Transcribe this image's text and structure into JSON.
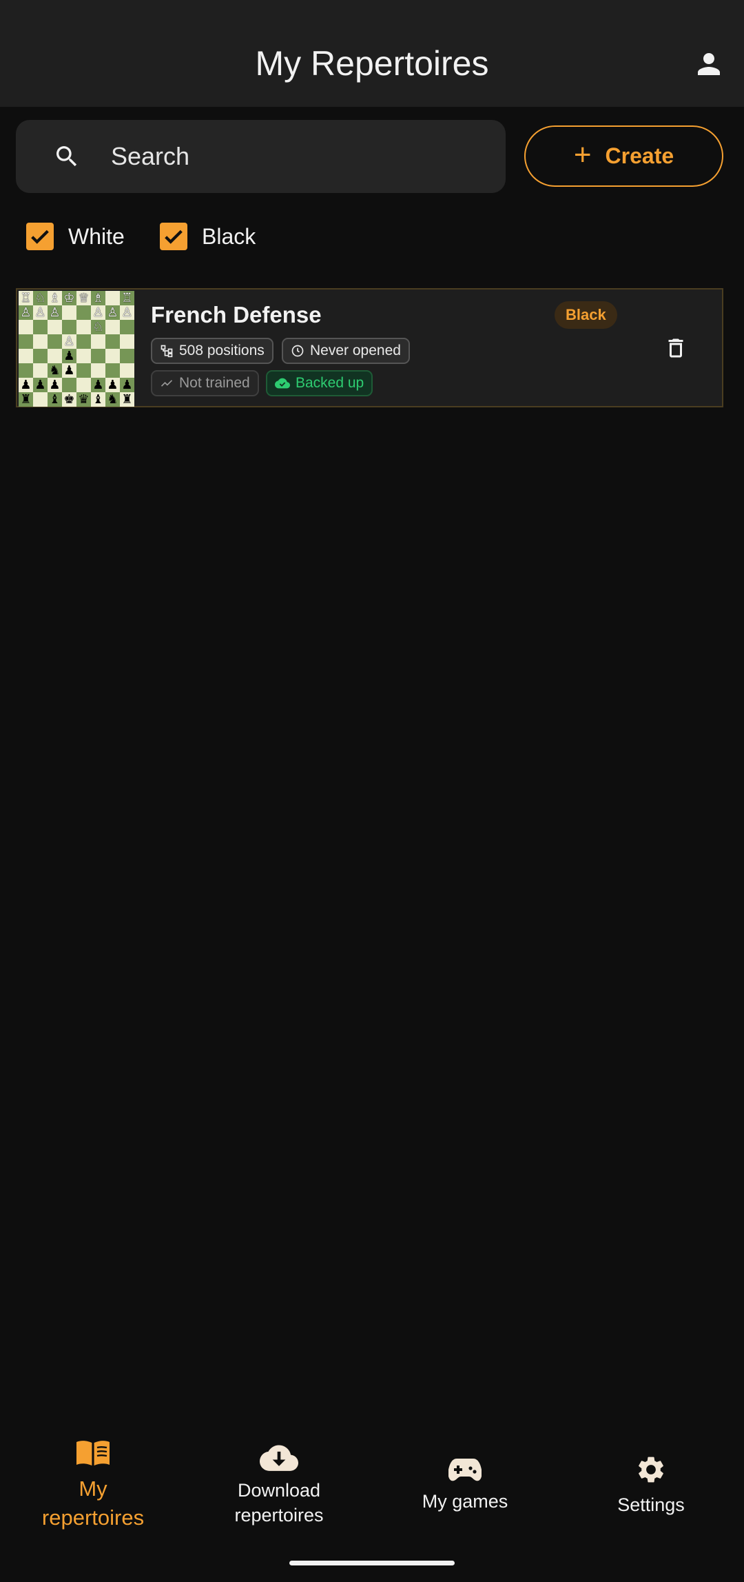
{
  "header": {
    "title": "My Repertoires",
    "account_icon": "person-icon"
  },
  "search": {
    "placeholder": "Search",
    "value": "",
    "icon": "search-icon"
  },
  "create_button": {
    "label": "Create",
    "icon": "plus-icon"
  },
  "filters": [
    {
      "label": "White",
      "checked": true
    },
    {
      "label": "Black",
      "checked": true
    }
  ],
  "repertoires": [
    {
      "name": "French Defense",
      "color_tag": "Black",
      "positions": "508 positions",
      "last_opened": "Never opened",
      "training": "Not trained",
      "backup": "Backed up",
      "delete_icon": "trash-icon"
    }
  ],
  "bottom_nav": [
    {
      "label": "My repertoires",
      "icon": "book-icon",
      "active": true
    },
    {
      "label": "Download repertoires",
      "icon": "cloud-download-icon",
      "active": false
    },
    {
      "label": "My games",
      "icon": "gamepad-icon",
      "active": false
    },
    {
      "label": "Settings",
      "icon": "gear-icon",
      "active": false
    }
  ],
  "colors": {
    "accent": "#f5a031",
    "background": "#0e0e0e",
    "surface": "#1f1f1f",
    "backup_green": "#2ecc71",
    "board_light": "#eeeed2",
    "board_dark": "#769656"
  }
}
